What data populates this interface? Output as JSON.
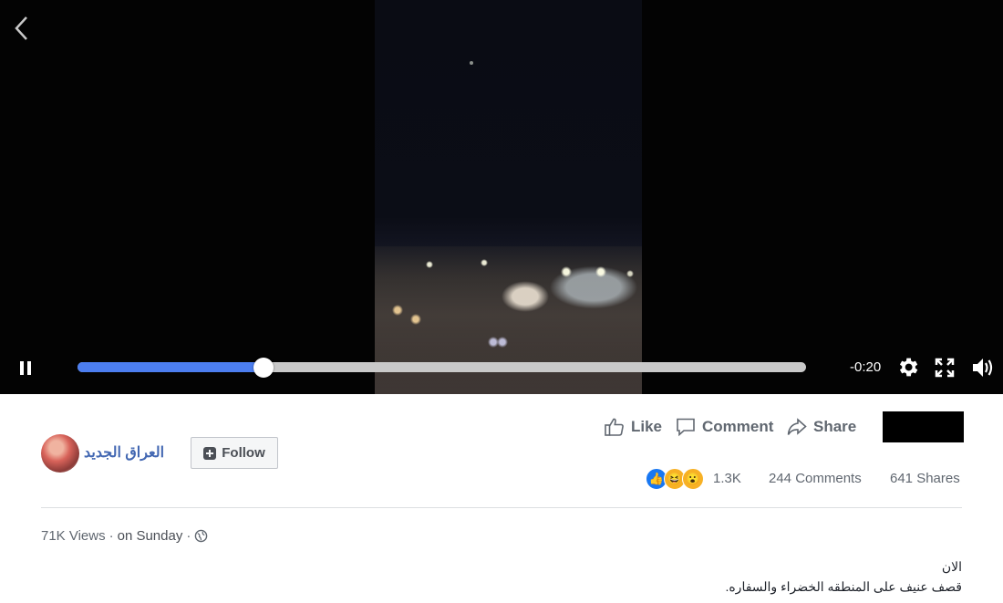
{
  "player": {
    "time_remaining": "-0:20",
    "progress": 0.255,
    "accent_color": "#4c7ef0"
  },
  "post": {
    "page_name": "العراق الجديد",
    "follow_label": "Follow",
    "actions": {
      "like": "Like",
      "comment": "Comment",
      "share": "Share"
    },
    "reaction_count": "1.3K",
    "comments": "244 Comments",
    "shares": "641 Shares",
    "views": "71K Views",
    "separator": "·",
    "date": "on Sunday",
    "description_line1": "الان",
    "description_line2": "قصف عنيف على المنطقه الخضراء والسفاره."
  },
  "icons": [
    "back-icon",
    "pause-icon",
    "settings-icon",
    "fullscreen-icon",
    "volume-icon",
    "like-icon",
    "comment-icon",
    "share-icon",
    "globe-icon"
  ]
}
